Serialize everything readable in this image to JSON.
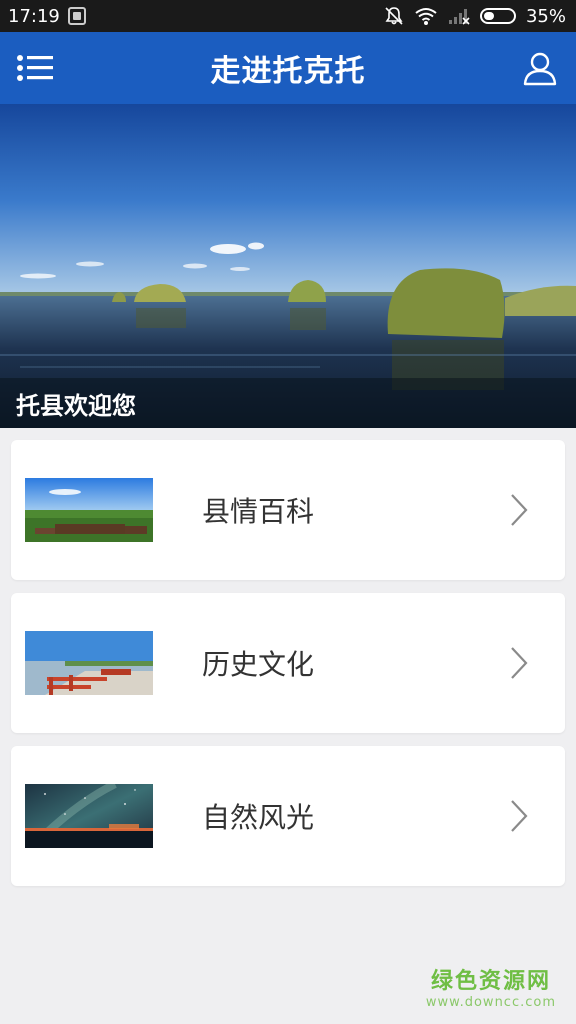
{
  "status_bar": {
    "time": "17:19",
    "battery_percent": "35%",
    "battery_level": 0.35
  },
  "header": {
    "title": "走进托克托",
    "menu_icon": "list-menu-icon",
    "user_icon": "user-icon"
  },
  "banner": {
    "caption": "托县欢迎您"
  },
  "cards": [
    {
      "label": "县情百科",
      "thumb": "grassland-horses",
      "chevron": "chevron-right-icon"
    },
    {
      "label": "历史文化",
      "thumb": "wooden-pier-lake",
      "chevron": "chevron-right-icon"
    },
    {
      "label": "自然风光",
      "thumb": "starry-night-sky",
      "chevron": "chevron-right-icon"
    }
  ],
  "watermark": {
    "title": "绿色资源网",
    "url": "www.downcc.com"
  },
  "colors": {
    "header_bg": "#1b5dc0",
    "page_bg": "#efeff1",
    "watermark_green": "#6fbe44"
  }
}
